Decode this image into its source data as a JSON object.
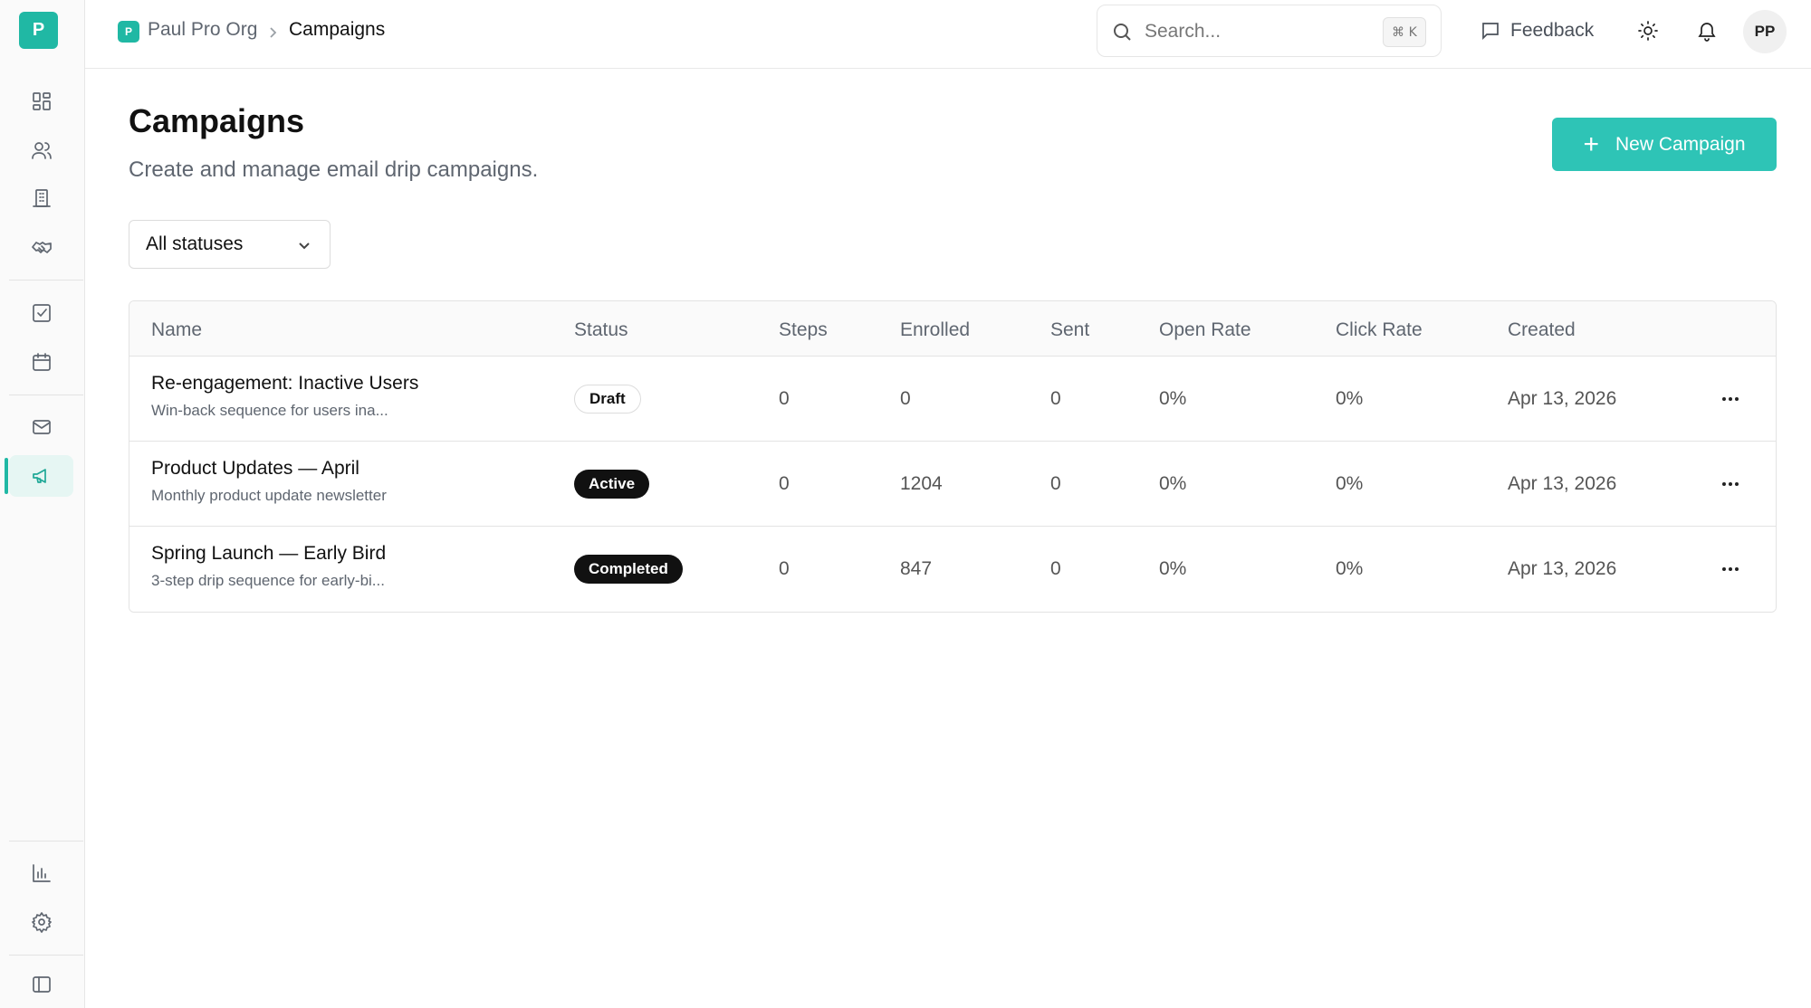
{
  "app": {
    "logo_letter": "P"
  },
  "breadcrumb": {
    "org_badge": "P",
    "org": "Paul Pro Org",
    "current": "Campaigns"
  },
  "search": {
    "placeholder": "Search...",
    "shortcut": "⌘ K"
  },
  "header": {
    "feedback_label": "Feedback",
    "avatar_initials": "PP"
  },
  "sidebar": {
    "items": [
      {
        "icon": "dashboard-icon"
      },
      {
        "icon": "users-icon"
      },
      {
        "icon": "building-icon"
      },
      {
        "icon": "handshake-icon"
      },
      {
        "icon": "tasks-icon"
      },
      {
        "icon": "calendar-icon"
      },
      {
        "icon": "mail-icon"
      },
      {
        "icon": "megaphone-icon",
        "active": true
      },
      {
        "icon": "analytics-icon"
      },
      {
        "icon": "settings-icon"
      },
      {
        "icon": "panel-toggle-icon"
      }
    ]
  },
  "page": {
    "title": "Campaigns",
    "subtitle": "Create and manage email drip campaigns.",
    "new_button": "New Campaign",
    "filter_value": "All statuses"
  },
  "table": {
    "columns": [
      "Name",
      "Status",
      "Steps",
      "Enrolled",
      "Sent",
      "Open Rate",
      "Click Rate",
      "Created"
    ],
    "rows": [
      {
        "name": "Re-engagement: Inactive Users",
        "desc": "Win-back sequence for users ina...",
        "status": "Draft",
        "steps": "0",
        "enrolled": "0",
        "sent": "0",
        "open_rate": "0%",
        "click_rate": "0%",
        "created": "Apr 13, 2026"
      },
      {
        "name": "Product Updates — April",
        "desc": "Monthly product update newsletter",
        "status": "Active",
        "steps": "0",
        "enrolled": "1204",
        "sent": "0",
        "open_rate": "0%",
        "click_rate": "0%",
        "created": "Apr 13, 2026"
      },
      {
        "name": "Spring Launch — Early Bird",
        "desc": "3-step drip sequence for early-bi...",
        "status": "Completed",
        "steps": "0",
        "enrolled": "847",
        "sent": "0",
        "open_rate": "0%",
        "click_rate": "0%",
        "created": "Apr 13, 2026"
      }
    ]
  },
  "colors": {
    "accent": "#20b8a4",
    "button": "#2ec4b6",
    "badge_dark": "#111111"
  }
}
